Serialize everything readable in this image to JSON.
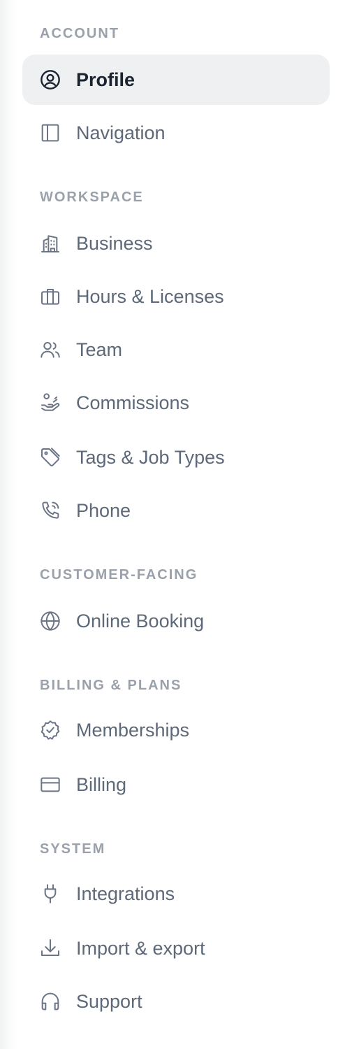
{
  "sections": {
    "account": {
      "label": "ACCOUNT",
      "items": [
        {
          "label": "Profile",
          "icon": "user-circle-icon",
          "active": true
        },
        {
          "label": "Navigation",
          "icon": "sidebar-panel-icon"
        }
      ]
    },
    "workspace": {
      "label": "WORKSPACE",
      "items": [
        {
          "label": "Business",
          "icon": "building-icon"
        },
        {
          "label": "Hours & Licenses",
          "icon": "briefcase-icon"
        },
        {
          "label": "Team",
          "icon": "users-icon"
        },
        {
          "label": "Commissions",
          "icon": "hand-coins-icon"
        },
        {
          "label": "Tags & Job Types",
          "icon": "tag-icon"
        },
        {
          "label": "Phone",
          "icon": "phone-icon"
        }
      ]
    },
    "customer_facing": {
      "label": "CUSTOMER-FACING",
      "items": [
        {
          "label": "Online Booking",
          "icon": "globe-icon"
        }
      ]
    },
    "billing_plans": {
      "label": "BILLING & PLANS",
      "items": [
        {
          "label": "Memberships",
          "icon": "badge-check-icon"
        },
        {
          "label": "Billing",
          "icon": "credit-card-icon"
        }
      ]
    },
    "system": {
      "label": "SYSTEM",
      "items": [
        {
          "label": "Integrations",
          "icon": "plug-icon"
        },
        {
          "label": "Import & export",
          "icon": "download-icon"
        },
        {
          "label": "Support",
          "icon": "headset-icon"
        }
      ]
    }
  },
  "colors": {
    "active_bg": "#eef0f2",
    "active_text": "#1b2430",
    "item_text": "#5d6878",
    "section_label": "#9aa1ab"
  }
}
